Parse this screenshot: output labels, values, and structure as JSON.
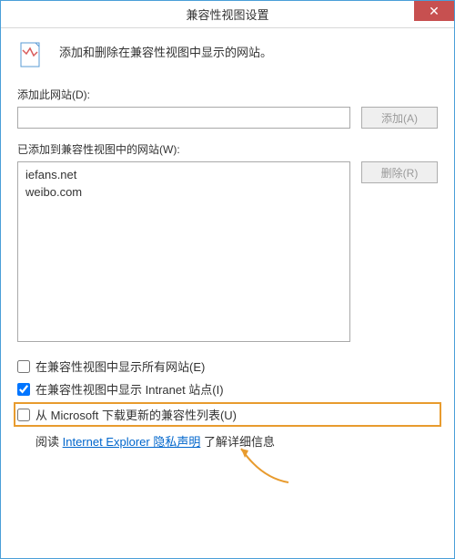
{
  "window": {
    "title": "兼容性视图设置"
  },
  "description": "添加和删除在兼容性视图中显示的网站。",
  "add_section": {
    "label": "添加此网站(D):",
    "input_value": "",
    "button_label": "添加(A)"
  },
  "list_section": {
    "label": "已添加到兼容性视图中的网站(W):",
    "items": [
      "iefans.net",
      "weibo.com"
    ],
    "remove_button_label": "删除(R)"
  },
  "checks": {
    "show_all": {
      "label": "在兼容性视图中显示所有网站(E)",
      "checked": false
    },
    "show_intranet": {
      "label": "在兼容性视图中显示 Intranet 站点(I)",
      "checked": true
    },
    "download_ms": {
      "label": "从 Microsoft 下载更新的兼容性列表(U)",
      "checked": false
    }
  },
  "read_line": {
    "prefix": "阅读 ",
    "link_text": "Internet Explorer 隐私声明",
    "suffix": " 了解详细信息"
  }
}
